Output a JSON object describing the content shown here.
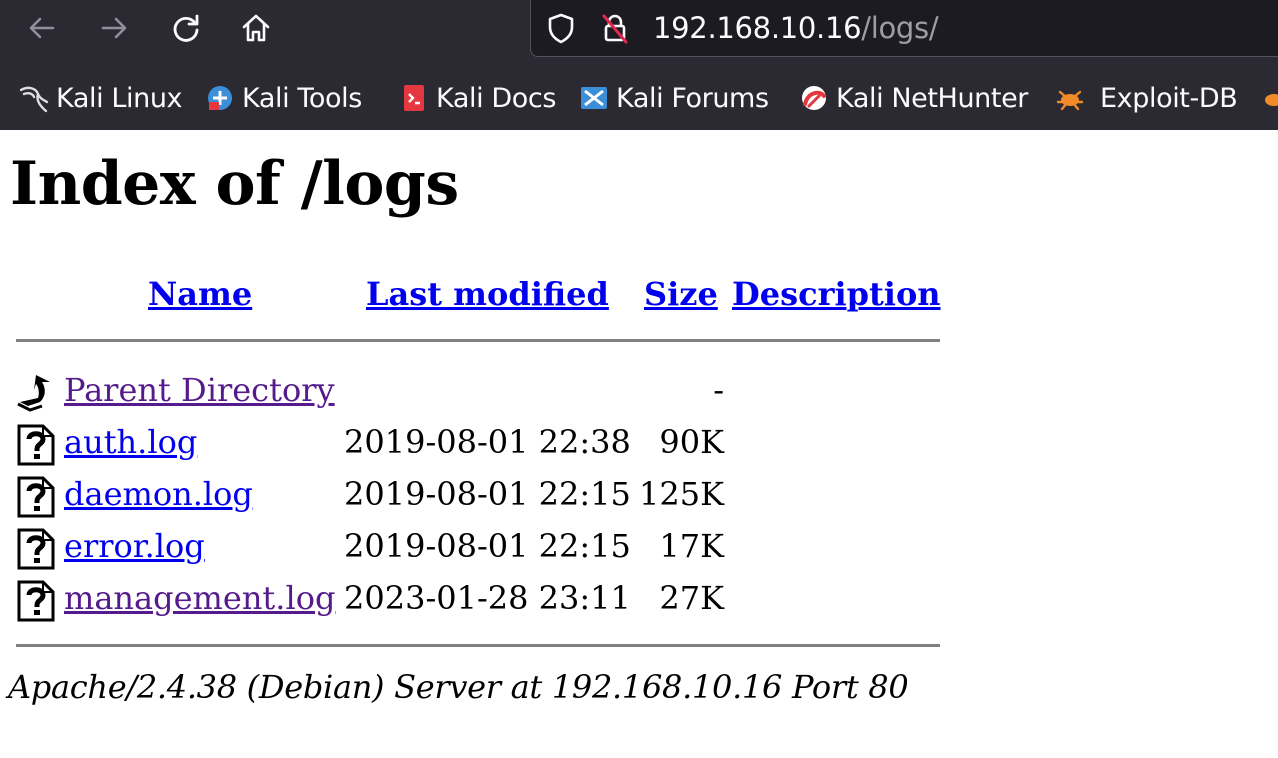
{
  "browser": {
    "url_host": "192.168.10.16",
    "url_path": "/logs/",
    "bookmarks": [
      {
        "label": "Kali Linux",
        "icon": "kali-dragon-icon"
      },
      {
        "label": "Kali Tools",
        "icon": "kali-tools-icon"
      },
      {
        "label": "Kali Docs",
        "icon": "kali-docs-icon"
      },
      {
        "label": "Kali Forums",
        "icon": "kali-forums-icon"
      },
      {
        "label": "Kali NetHunter",
        "icon": "kali-nethunter-icon"
      },
      {
        "label": "Exploit-DB",
        "icon": "exploit-db-icon"
      }
    ],
    "colors": {
      "toolbar": "#2b2a33",
      "urlbar": "#1c1b22",
      "text": "#fbfbfe",
      "url_path": "#9d9da6"
    }
  },
  "page": {
    "title": "Index of /logs",
    "columns": {
      "name": "Name",
      "last_modified": "Last modified",
      "size": "Size",
      "description": "Description"
    },
    "parent": {
      "name": "Parent Directory",
      "size": "-",
      "icon": "back-arrow-icon"
    },
    "files": [
      {
        "name": "auth.log",
        "date": "2019-08-01 22:38",
        "size": "90K",
        "icon": "unknown-file-icon",
        "visited": false
      },
      {
        "name": "daemon.log",
        "date": "2019-08-01 22:15",
        "size": "125K",
        "icon": "unknown-file-icon",
        "visited": false
      },
      {
        "name": "error.log",
        "date": "2019-08-01 22:15",
        "size": "17K",
        "icon": "unknown-file-icon",
        "visited": false
      },
      {
        "name": "management.log",
        "date": "2023-01-28 23:11",
        "size": "27K",
        "icon": "unknown-file-icon",
        "visited": true
      }
    ],
    "address": "Apache/2.4.38 (Debian) Server at 192.168.10.16 Port 80",
    "colors": {
      "link": "#0000ee",
      "visited_link": "#551a8b",
      "rule": "#808080"
    }
  }
}
